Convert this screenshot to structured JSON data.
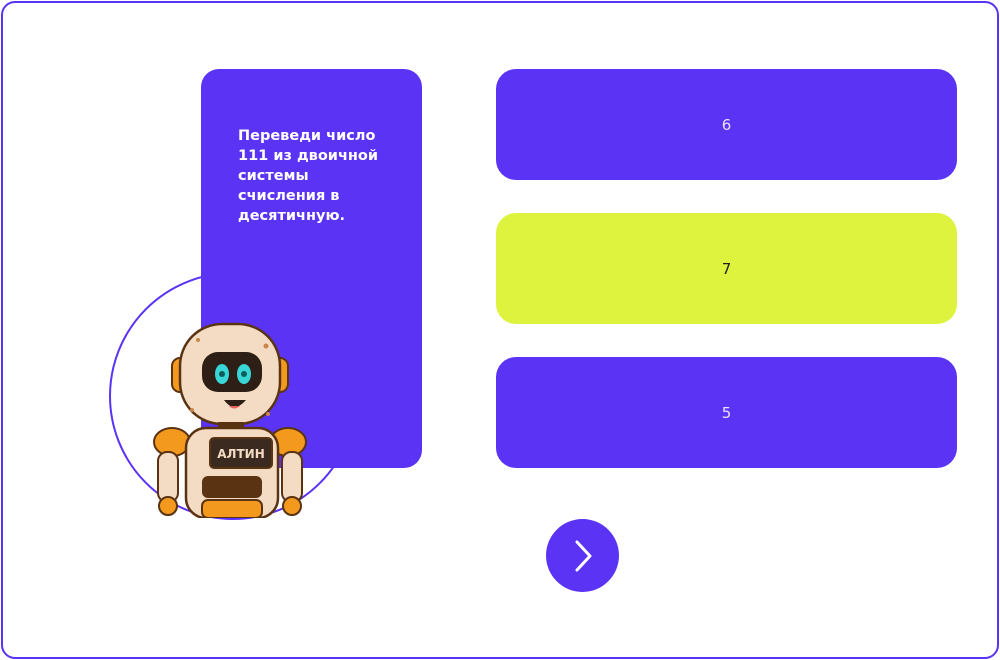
{
  "question": {
    "text": "Переведи число 111 из двоичной системы счисления в десятичную."
  },
  "mascot": {
    "badge_text": "АЛТИН",
    "icon": "robot-mascot"
  },
  "answers": [
    {
      "label": "6",
      "state": "default"
    },
    {
      "label": "7",
      "state": "selected"
    },
    {
      "label": "5",
      "state": "default"
    }
  ],
  "next_button": {
    "icon": "chevron-right-icon"
  },
  "colors": {
    "primary": "#5b33f5",
    "selected": "#def33d",
    "border": "#5b33f5"
  }
}
